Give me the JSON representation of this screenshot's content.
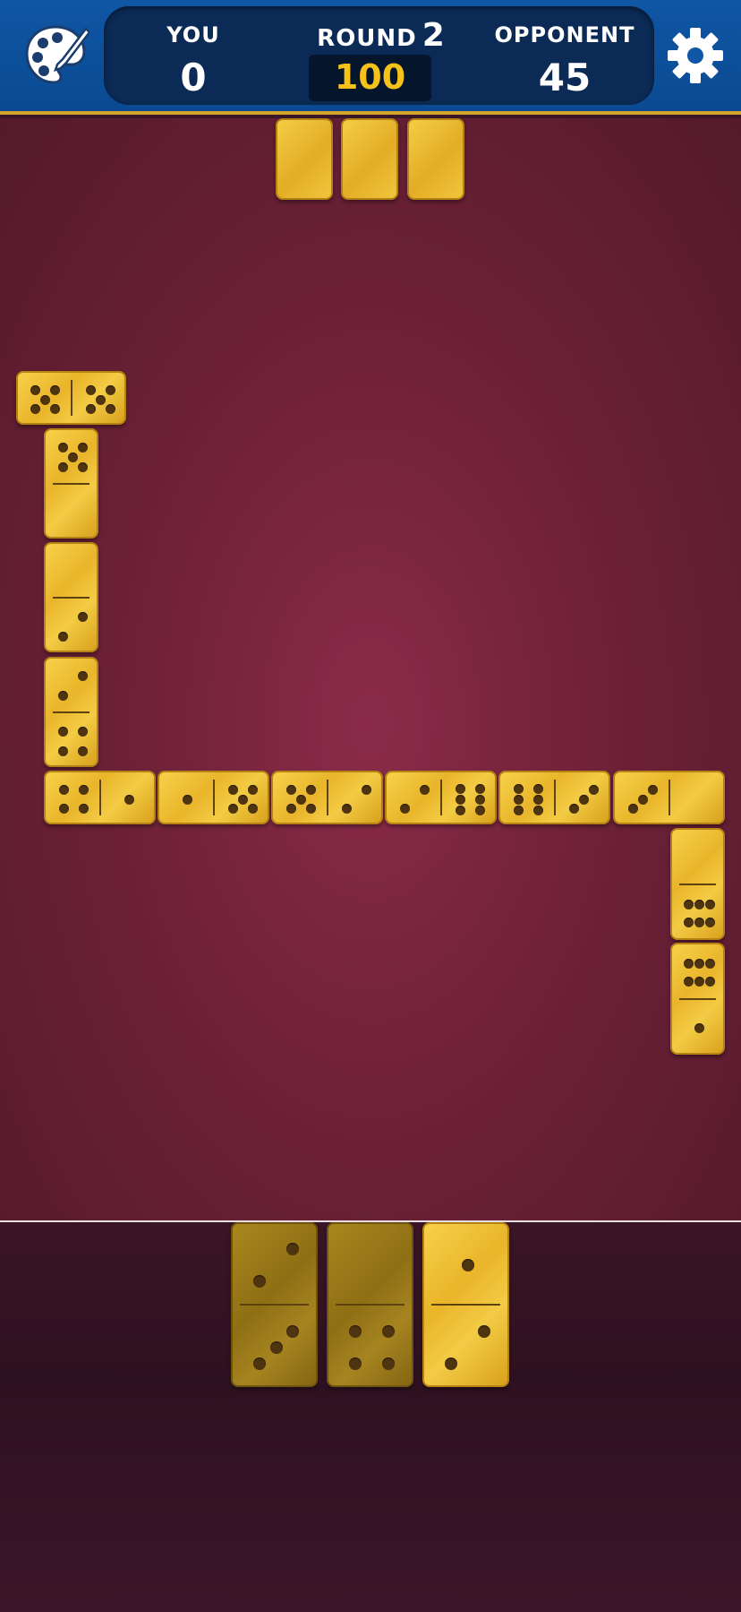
{
  "header": {
    "you_label": "YOU",
    "you_score": "0",
    "round_label": "ROUND",
    "round_number": "2",
    "target_score": "100",
    "opponent_label": "OPPONENT",
    "opponent_score": "45",
    "left_icon": "palette-icon",
    "right_icon": "gear-icon"
  },
  "opponent_hand_count": 3,
  "board": [
    {
      "a": 5,
      "b": 5,
      "orient": "h"
    },
    {
      "a": 5,
      "b": 0,
      "orient": "v"
    },
    {
      "a": 0,
      "b": 2,
      "orient": "v"
    },
    {
      "a": 2,
      "b": 4,
      "orient": "v"
    },
    {
      "a": 4,
      "b": 1,
      "orient": "h"
    },
    {
      "a": 1,
      "b": 5,
      "orient": "h"
    },
    {
      "a": 5,
      "b": 2,
      "orient": "h"
    },
    {
      "a": 2,
      "b": 6,
      "orient": "h"
    },
    {
      "a": 6,
      "b": 3,
      "orient": "h"
    },
    {
      "a": 3,
      "b": 0,
      "orient": "h"
    },
    {
      "a": 0,
      "b": 6,
      "orient": "v"
    },
    {
      "a": 6,
      "b": 1,
      "orient": "v"
    }
  ],
  "player_hand": [
    {
      "a": 2,
      "b": 3,
      "playable": false
    },
    {
      "a": 0,
      "b": 4,
      "playable": false
    },
    {
      "a": 1,
      "b": 2,
      "playable": true
    }
  ],
  "colors": {
    "header_blue": "#0f56a4",
    "score_panel": "#0b2a55",
    "target_gold": "#f5c21a",
    "table_felt": "#6e2138",
    "domino_gold": "#e9b52a"
  }
}
